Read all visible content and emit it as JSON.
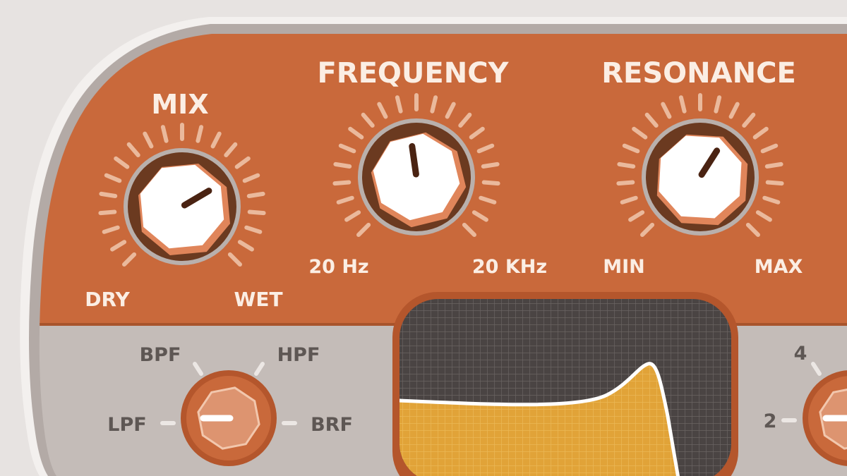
{
  "colors": {
    "background": "#e7e3e1",
    "panel_orange": "#c9693b",
    "panel_gray": "#c4bcb8",
    "panel_rim": "#b3aaa6",
    "knob_ring": "#6b3a20",
    "knob_face": "#ffffff",
    "tick": "#f0c7ad",
    "label_light": "#fbeee4",
    "label_dark": "#5e5754",
    "screen_bg": "#4a4443",
    "curve_fill": "#e1a338"
  },
  "mix": {
    "title": "MIX",
    "min_label": "DRY",
    "max_label": "WET",
    "level_fraction": 0.62,
    "icon": "rotary-knob"
  },
  "frequency": {
    "title": "FREQUENCY",
    "min_label": "20 Hz",
    "max_label": "20 KHz",
    "level_fraction": 0.47,
    "icon": "rotary-knob"
  },
  "resonance": {
    "title": "RESONANCE",
    "min_label": "MIN",
    "max_label": "MAX",
    "level_fraction": 0.62,
    "icon": "rotary-knob"
  },
  "filter_type": {
    "options": [
      "LPF",
      "BPF",
      "HPF",
      "BRF"
    ],
    "selected": "LPF",
    "icon": "selector-knob"
  },
  "slope": {
    "visible_labels": [
      "4",
      "2"
    ],
    "icon": "selector-knob"
  },
  "response_display": {
    "icon": "filter-response-curve",
    "grid": true,
    "shape": "low-pass with resonance peak"
  }
}
